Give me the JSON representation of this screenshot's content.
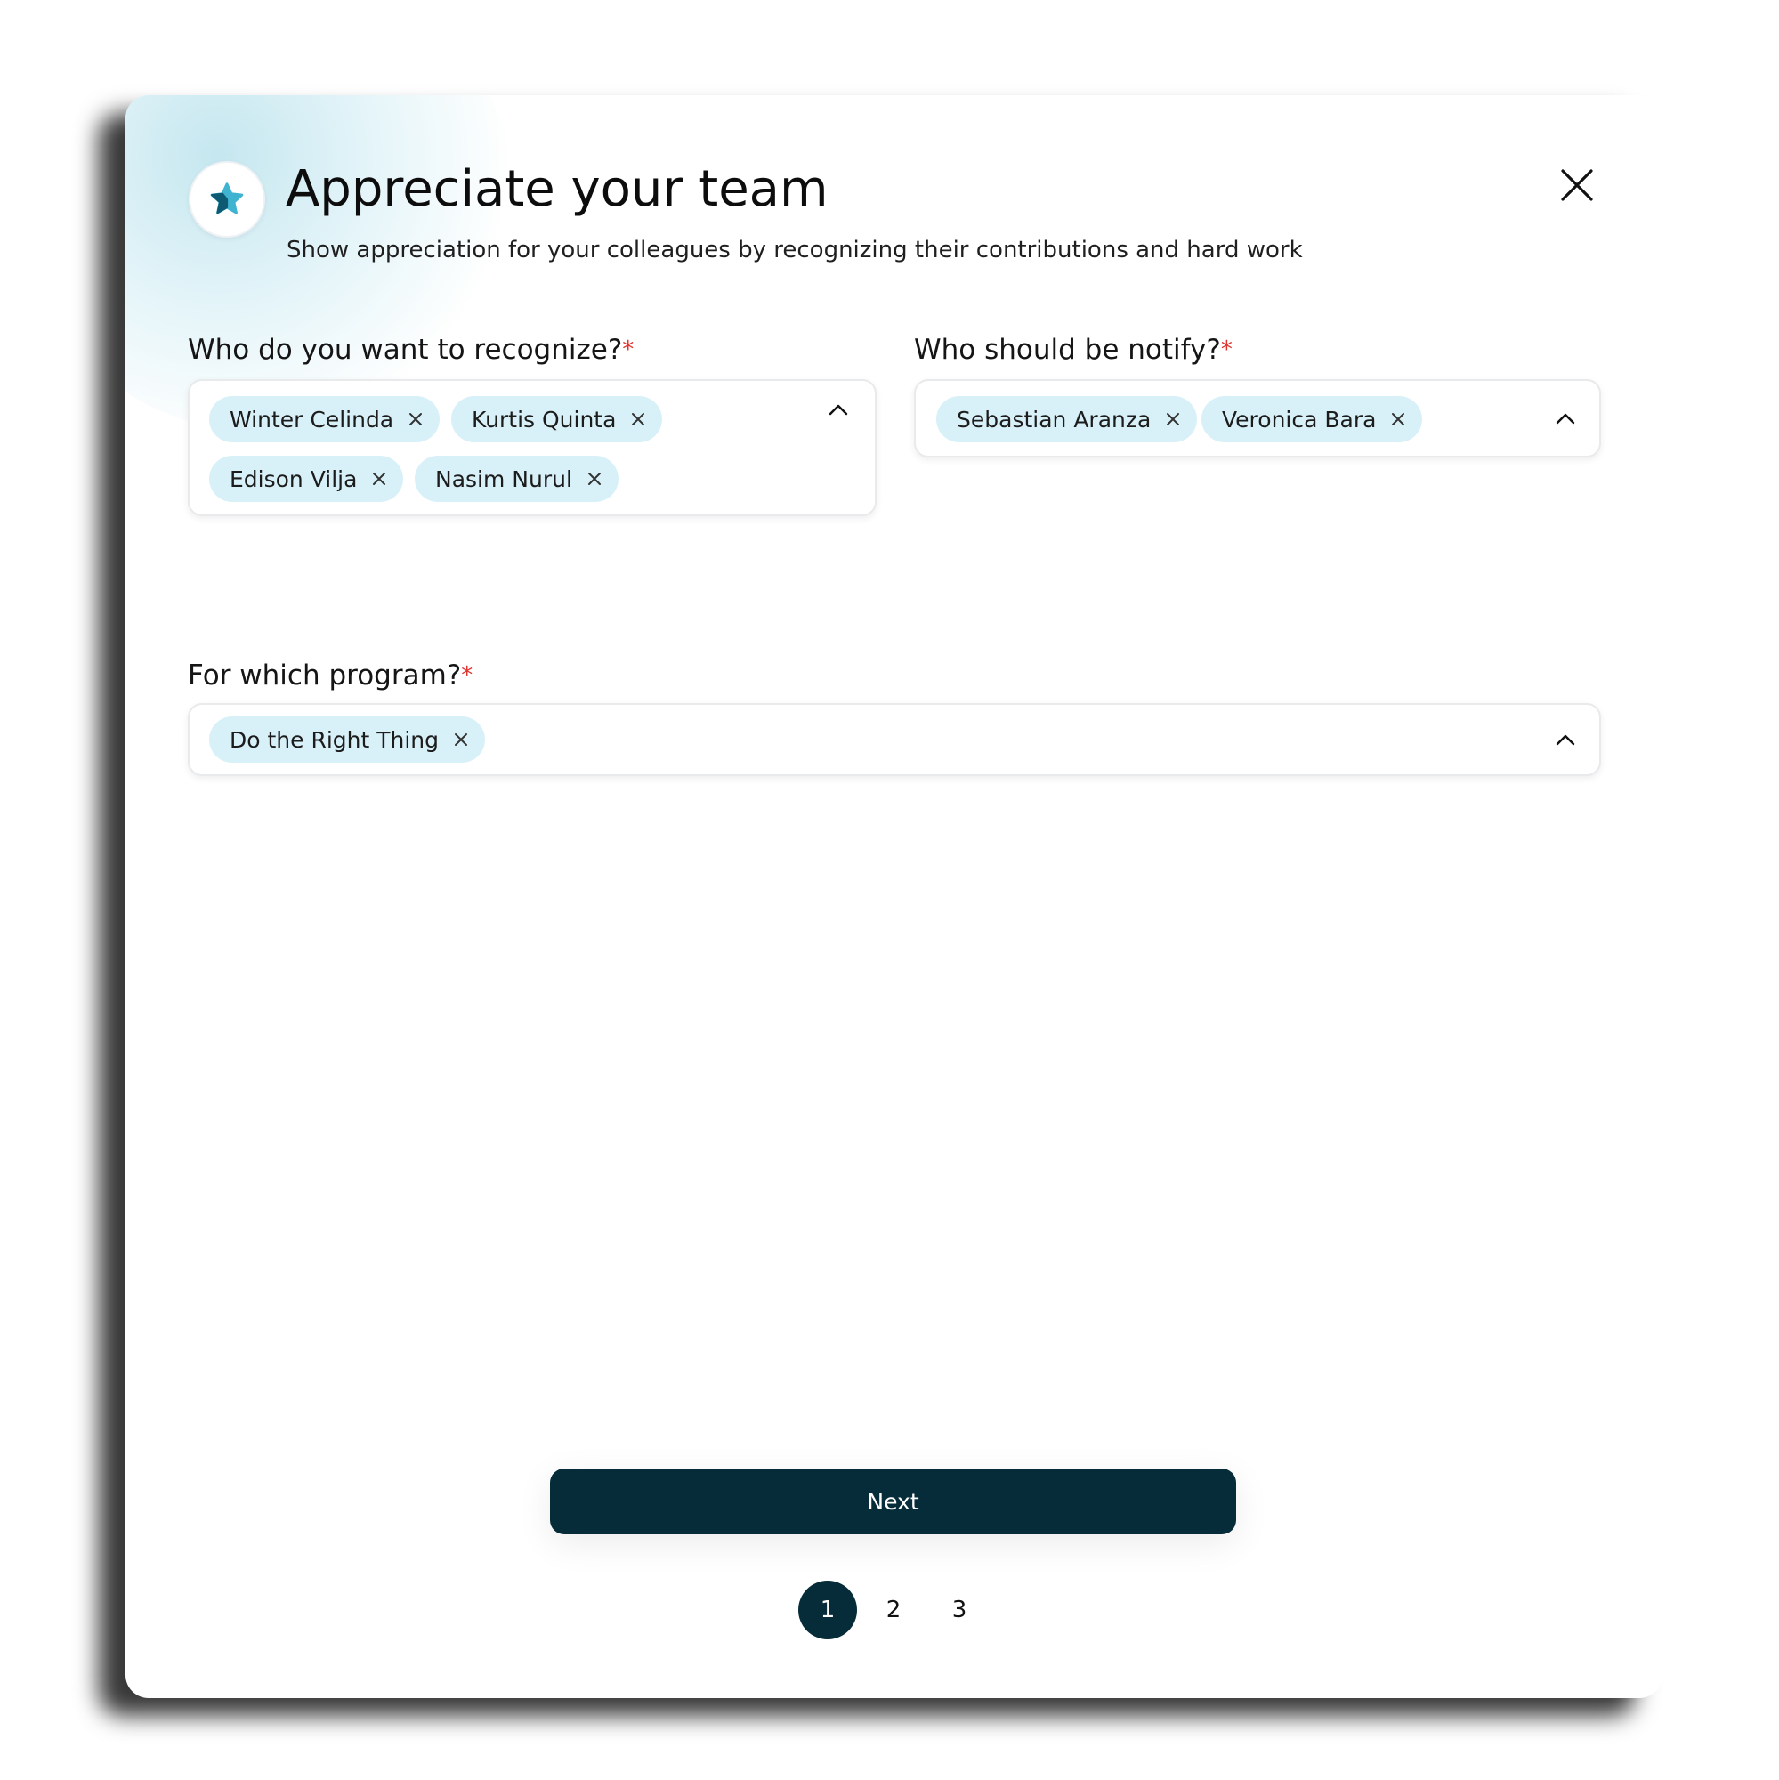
{
  "modal": {
    "title": "Appreciate your team",
    "subtitle": "Show appreciation for your colleagues by recognizing their contributions and hard work",
    "icon": "star-icon",
    "close_icon": "close-icon",
    "accent_color": "#062b39",
    "chip_color": "#d8f1f8",
    "required_color": "#e0332f"
  },
  "recognize": {
    "label": "Who do you want to recognize?",
    "required_mark": "*",
    "chips": [
      "Winter Celinda",
      "Kurtis Quinta",
      "Edison Vilja",
      "Nasim Nurul"
    ]
  },
  "notify": {
    "label": "Who should be notify?",
    "required_mark": "*",
    "chips": [
      "Sebastian Aranza",
      "Veronica Bara"
    ]
  },
  "program": {
    "label": "For which program?",
    "required_mark": "*",
    "chips": [
      "Do the Right Thing"
    ]
  },
  "footer": {
    "next_label": "Next",
    "pages": [
      "1",
      "2",
      "3"
    ],
    "current_page": "1"
  }
}
